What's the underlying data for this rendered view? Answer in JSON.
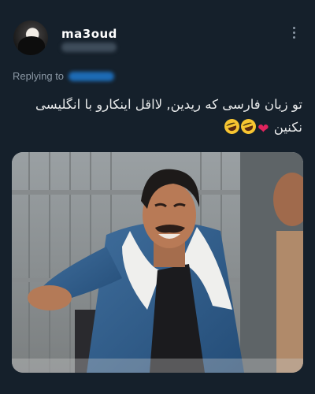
{
  "tweet": {
    "display_name": "ma3oud",
    "replying_to_label": "Replying to",
    "text_line1": "تو زبان فارسی که ریدین, لااقل اینکارو با انگلیسی",
    "text_line2": "نکنین",
    "emoji_icons": [
      "broken-heart-icon",
      "rolling-on-floor-laughing-icon",
      "rolling-on-floor-laughing-icon"
    ]
  },
  "colors": {
    "background": "#15202b",
    "text": "#e7e9ea",
    "secondary_text": "#8b98a5",
    "link": "#1d9bf0"
  }
}
